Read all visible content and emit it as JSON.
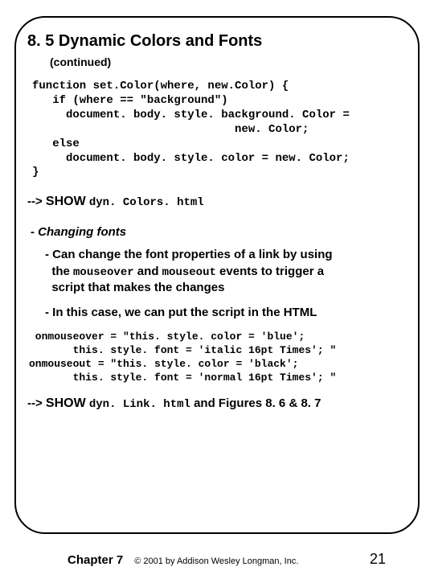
{
  "title": "8. 5 Dynamic Colors and Fonts",
  "subtitle": "(continued)",
  "code1": "function set.Color(where, new.Color) {\n   if (where == \"background\")\n     document. body. style. background. Color =\n                              new. Color;\n   else\n     document. body. style. color = new. Color;\n}",
  "show1_arrow": "-->",
  "show1_label": "SHOW",
  "show1_file": "dyn. Colors. html",
  "section_head": "- Changing fonts",
  "bullet1_a": "- Can change the font properties of a link by using",
  "bullet1_b": "the ",
  "bullet1_code1": "mouseover",
  "bullet1_c": " and ",
  "bullet1_code2": "mouseout",
  "bullet1_d": " events to trigger a",
  "bullet1_e": "script that makes the changes",
  "bullet2": "- In this case, we can put the script in the HTML",
  "code2": " onmouseover = \"this. style. color = 'blue';\n       this. style. font = 'italic 16pt Times'; \"\nonmouseout = \"this. style. color = 'black';\n       this. style. font = 'normal 16pt Times'; \"",
  "show2_arrow": "-->",
  "show2_label": "SHOW",
  "show2_file": "dyn. Link. html",
  "show2_rest": " and Figures 8. 6 & 8. 7",
  "footer": {
    "chapter": "Chapter 7",
    "copyright": "© 2001 by Addison Wesley Longman, Inc.",
    "pagenum": "21"
  }
}
